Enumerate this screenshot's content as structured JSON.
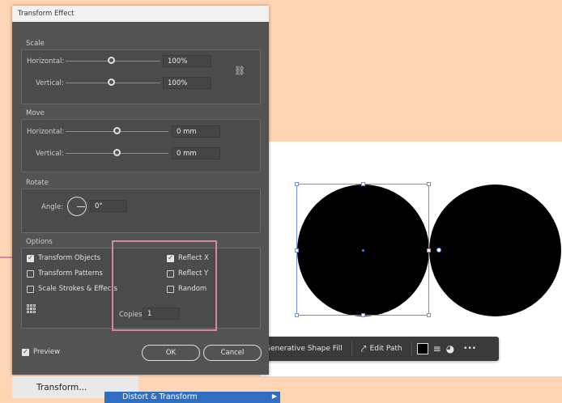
{
  "dialog": {
    "title": "Transform Effect",
    "scale": {
      "title": "Scale",
      "horizontal_label": "Horizontal:",
      "horizontal_value": "100%",
      "vertical_label": "Vertical:",
      "vertical_value": "100%",
      "link_icon": "unlink-icon"
    },
    "move": {
      "title": "Move",
      "horizontal_label": "Horizontal:",
      "horizontal_value": "0 mm",
      "vertical_label": "Vertical:",
      "vertical_value": "0 mm"
    },
    "rotate": {
      "title": "Rotate",
      "angle_label": "Angle:",
      "angle_value": "0°"
    },
    "options": {
      "title": "Options",
      "transform_objects": "Transform Objects",
      "transform_patterns": "Transform Patterns",
      "scale_strokes": "Scale Strokes & Effects",
      "reflect_x": "Reflect X",
      "reflect_y": "Reflect Y",
      "random": "Random",
      "copies_label": "Copies:",
      "copies_value": "1"
    },
    "preview_label": "Preview",
    "ok_label": "OK",
    "cancel_label": "Cancel"
  },
  "taskbar": {
    "generative_fill": "Generative Shape Fill",
    "edit_path": "Edit Path",
    "more": "•••"
  },
  "menu": {
    "transform": "Transform...",
    "distort_transform": "Distort & Transform"
  },
  "colors": {
    "background": "#ffd6b5",
    "dialog": "#535353",
    "highlight": "#d7889b",
    "selection": "#4f7fe6",
    "menu_active": "#2f6ec0"
  }
}
